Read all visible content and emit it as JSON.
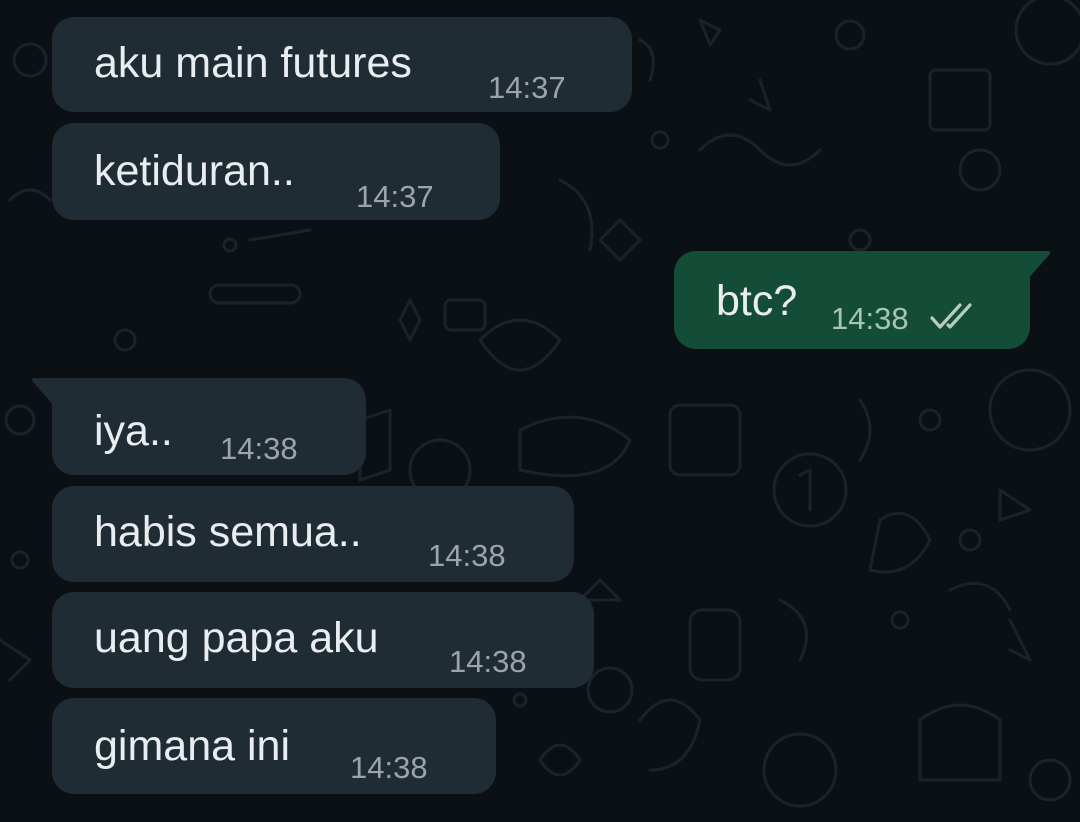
{
  "chat": {
    "messages": [
      {
        "direction": "incoming",
        "text": "aku main futures",
        "time": "14:37"
      },
      {
        "direction": "incoming",
        "text": "ketiduran..",
        "time": "14:37"
      },
      {
        "direction": "outgoing",
        "text": "btc?",
        "time": "14:38",
        "status_icon": "double-check-read-icon"
      },
      {
        "direction": "incoming",
        "text": "iya..",
        "time": "14:38"
      },
      {
        "direction": "incoming",
        "text": "habis semua..",
        "time": "14:38"
      },
      {
        "direction": "incoming",
        "text": "uang papa aku",
        "time": "14:38"
      },
      {
        "direction": "incoming",
        "text": "gimana ini",
        "time": "14:38"
      }
    ]
  },
  "colors": {
    "background": "#0b1014",
    "incoming_bubble": "#202c33",
    "outgoing_bubble": "#144d37",
    "text": "#e9edef",
    "timestamp": "#9aa4a9"
  }
}
